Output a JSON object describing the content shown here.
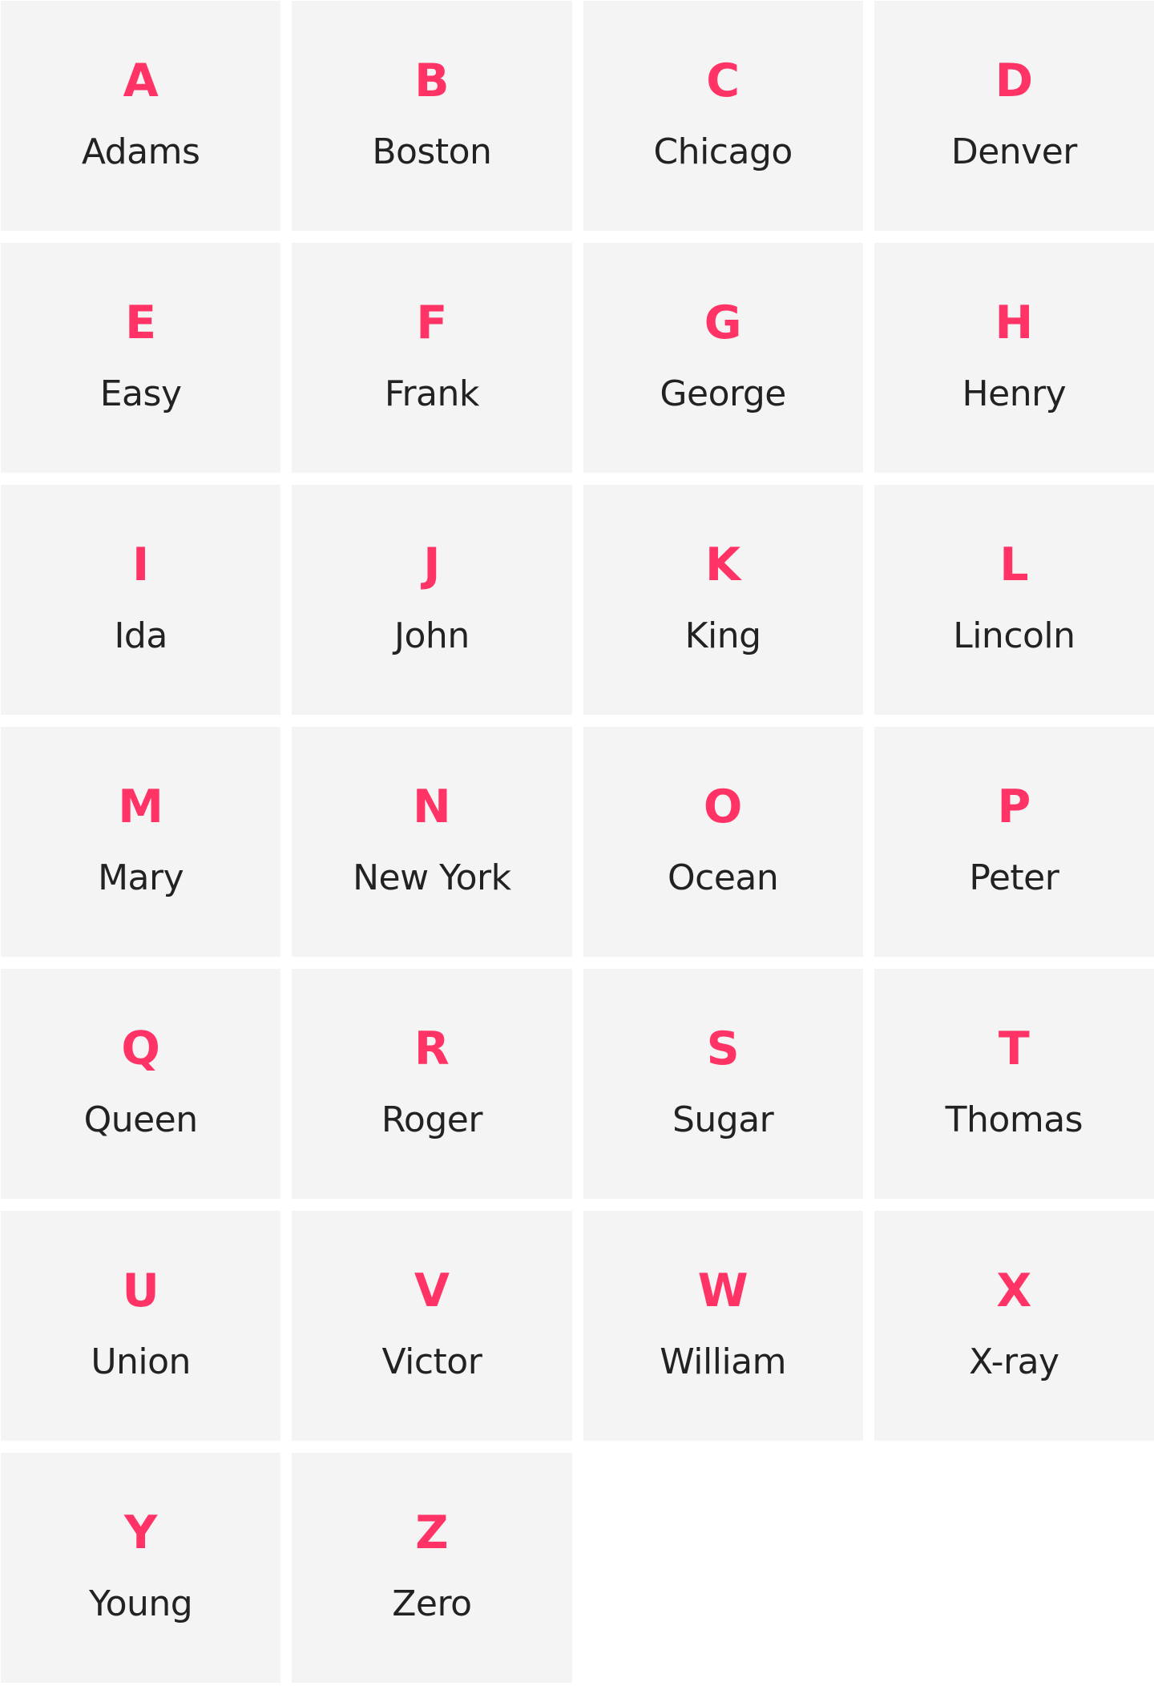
{
  "accent_color": "#ff3366",
  "text_color": "#222222",
  "tile_color": "#f4f4f4",
  "alphabet": [
    {
      "letter": "A",
      "word": "Adams"
    },
    {
      "letter": "B",
      "word": "Boston"
    },
    {
      "letter": "C",
      "word": "Chicago"
    },
    {
      "letter": "D",
      "word": "Denver"
    },
    {
      "letter": "E",
      "word": "Easy"
    },
    {
      "letter": "F",
      "word": "Frank"
    },
    {
      "letter": "G",
      "word": "George"
    },
    {
      "letter": "H",
      "word": "Henry"
    },
    {
      "letter": "I",
      "word": "Ida"
    },
    {
      "letter": "J",
      "word": "John"
    },
    {
      "letter": "K",
      "word": "King"
    },
    {
      "letter": "L",
      "word": "Lincoln"
    },
    {
      "letter": "M",
      "word": "Mary"
    },
    {
      "letter": "N",
      "word": "New York"
    },
    {
      "letter": "O",
      "word": "Ocean"
    },
    {
      "letter": "P",
      "word": "Peter"
    },
    {
      "letter": "Q",
      "word": "Queen"
    },
    {
      "letter": "R",
      "word": "Roger"
    },
    {
      "letter": "S",
      "word": "Sugar"
    },
    {
      "letter": "T",
      "word": "Thomas"
    },
    {
      "letter": "U",
      "word": "Union"
    },
    {
      "letter": "V",
      "word": "Victor"
    },
    {
      "letter": "W",
      "word": "William"
    },
    {
      "letter": "X",
      "word": "X-ray"
    },
    {
      "letter": "Y",
      "word": "Young"
    },
    {
      "letter": "Z",
      "word": "Zero"
    }
  ]
}
